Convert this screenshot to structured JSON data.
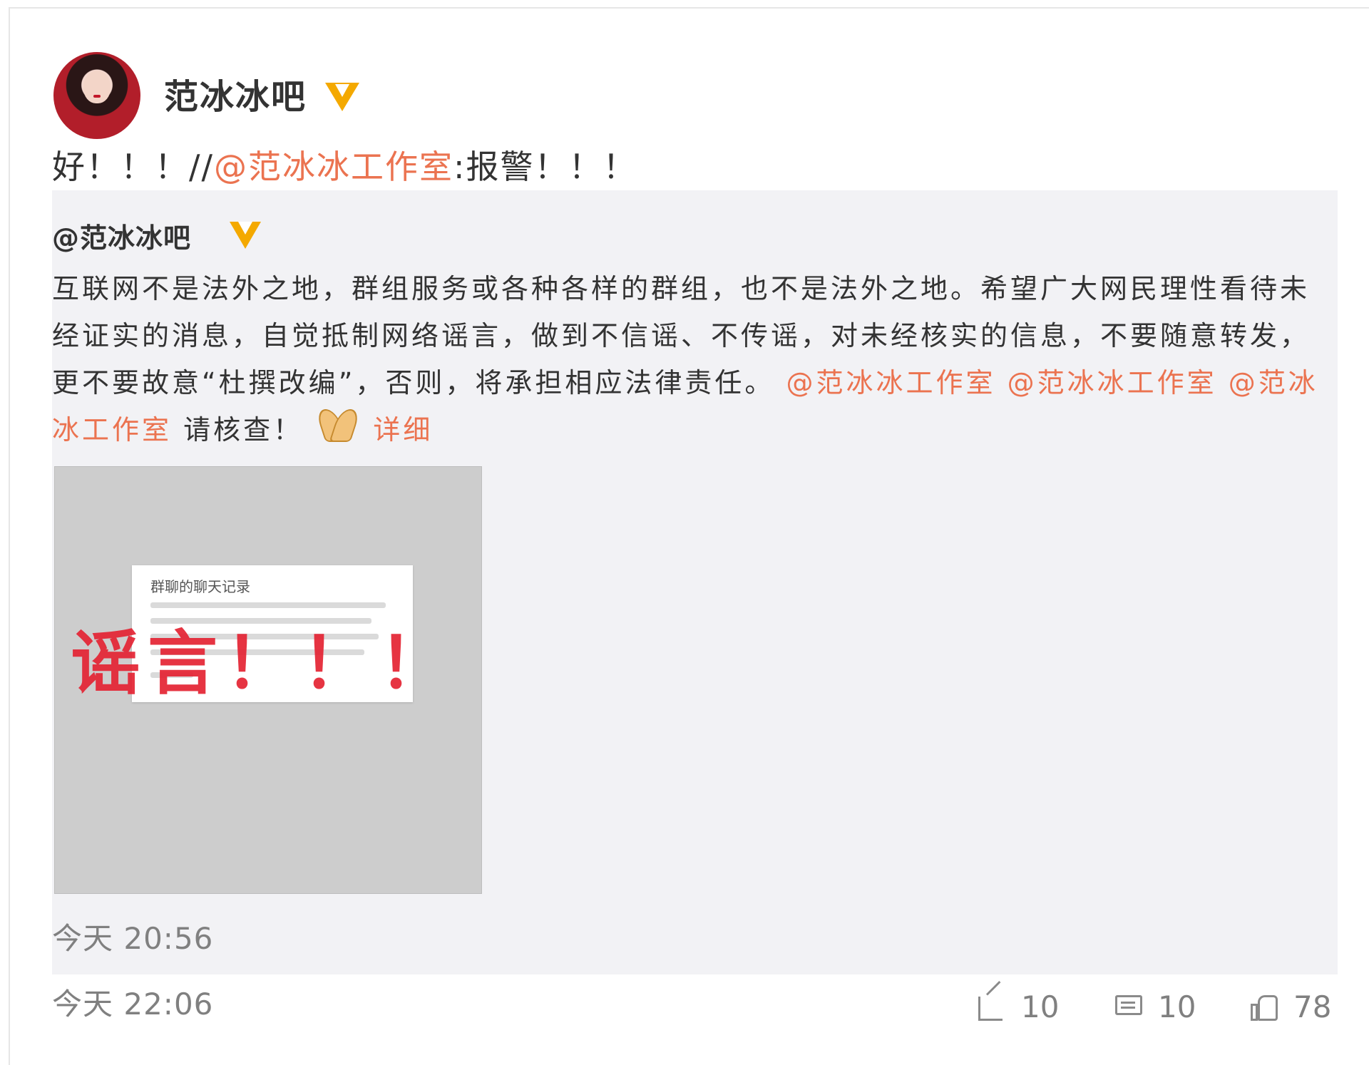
{
  "post": {
    "author_name": "范冰冰吧",
    "verified_icon": "verified-v-icon",
    "repost_text": "好！！！//",
    "repost_mention": "@范冰冰工作室",
    "repost_text_tail": ":报警！！！",
    "time": "今天 22:06"
  },
  "original": {
    "author": "@范冰冰吧",
    "text": "互联网不是法外之地，群组服务或各种各样的群组，也不是法外之地。希望广大网民理性看待未经证实的消息，自觉抵制网络谣言，做到不信谣、不传谣，对未经核实的信息，不要随意转发，更不要故意“杜撰改编”，否则，将承担相应法律责任。",
    "mentions": [
      "@范冰冰工作室",
      "@范冰冰工作室",
      "@范冰冰工作室"
    ],
    "tail_text": "请核查！",
    "emoji": "praying-hands-icon",
    "detail_link": "详细",
    "time": "今天 20:56",
    "image": {
      "card_title": "群聊的聊天记录",
      "stamp_text": "谣言！！！"
    }
  },
  "actions": {
    "repost_count": "10",
    "comment_count": "10",
    "like_count": "78"
  },
  "colors": {
    "link": "#eb7350",
    "verified": "#f4a900",
    "stamp": "#e42333",
    "quote_bg": "#f2f2f5"
  }
}
